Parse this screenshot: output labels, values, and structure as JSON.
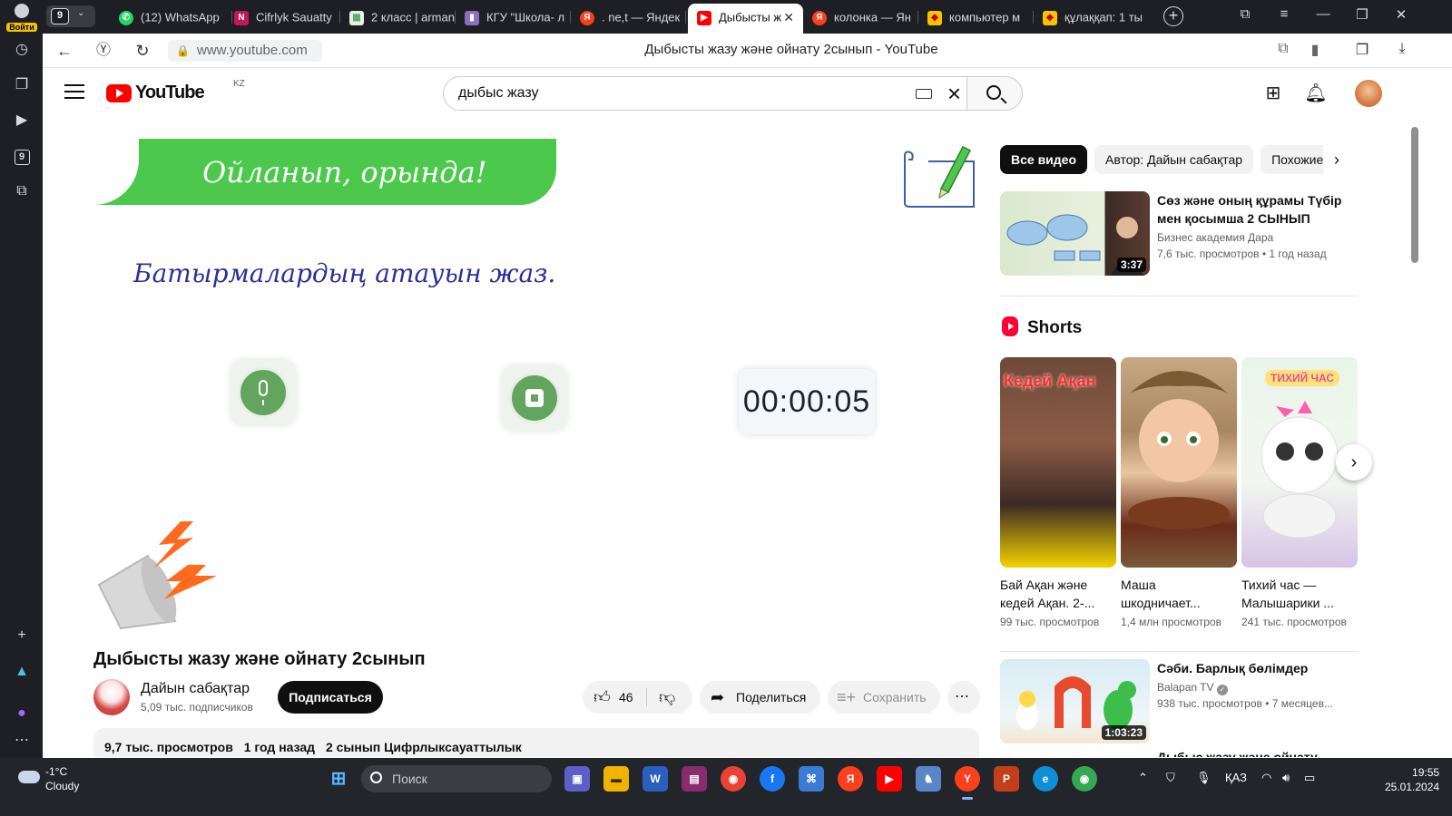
{
  "browser": {
    "login_label": "Войти",
    "tab_count": "9",
    "tabs": [
      {
        "title": "(12) WhatsApp",
        "icon": "whatsapp-icon",
        "color": "#25d366"
      },
      {
        "title": "Cifrlyk Sauatty",
        "icon": "cifrlyk-icon",
        "color": "#c2185b"
      },
      {
        "title": "2 класс | arman",
        "icon": "arman-icon",
        "color": "#5aa469"
      },
      {
        "title": "КГУ \"Школа- л",
        "icon": "school-icon",
        "color": "#8e6cc0"
      },
      {
        "title": ". ne,t — Яндек",
        "icon": "yandex-icon",
        "color": "#fc3f1d"
      },
      {
        "title": "Дыбысты ж",
        "icon": "youtube-icon",
        "color": "#ff0000"
      },
      {
        "title": "колонка — Ян",
        "icon": "yandex-icon",
        "color": "#fc3f1d"
      },
      {
        "title": "компьютер м",
        "icon": "images-icon",
        "color": "#f8c300"
      },
      {
        "title": "құлаққап: 1 ты",
        "icon": "images-icon",
        "color": "#f8c300"
      }
    ],
    "url": "www.youtube.com",
    "page_title": "Дыбысты жазу және ойнату 2сынып - YouTube"
  },
  "youtube": {
    "logo_text": "YouTube",
    "country_code": "KZ",
    "search_value": "дыбыс жазу"
  },
  "video": {
    "banner_text": "Ойланып, орында!",
    "task_text": "Батырмалардың атауын жаз.",
    "timer": "00:00:05",
    "title": "Дыбысты жазу және ойнату 2сынып",
    "channel": "Дайын сабақтар",
    "subscribers": "5,09 тыс. подписчиков",
    "subscribe_label": "Подписаться",
    "likes": "46",
    "share_label": "Поделиться",
    "save_label": "Сохранить",
    "views": "9,7 тыс. просмотров",
    "age": "1 год назад",
    "tags": "2 сынып Цифрлыксауаттылык"
  },
  "sidebar": {
    "chips": [
      "Все видео",
      "Автор: Дайын сабақтар",
      "Похожие"
    ],
    "recommendations": [
      {
        "title": "Сөз және оның құрамы Түбір мен қосымша 2 СЫНЫП",
        "channel": "Бизнес академия Дара",
        "meta": "7,6 тыс. просмотров • 1 год назад",
        "duration": "3:37"
      },
      {
        "title": "Сәби. Барлық бөлімдер",
        "channel": "Balapan TV",
        "meta": "938 тыс. просмотров • 7 месяцев...",
        "duration": "1:03:23"
      }
    ],
    "shorts_heading": "Shorts",
    "shorts": [
      {
        "title": "Бай Ақан және кедей Ақан. 2-...",
        "views": "99 тыс. просмотров",
        "overlay": "Кедей Ақан"
      },
      {
        "title": "Маша шкодничает...",
        "views": "1,4 млн просмотров",
        "overlay": ""
      },
      {
        "title": "Тихий час — Малышарики ...",
        "views": "241 тыс. просмотров",
        "overlay": "ТИХИЙ ЧАС"
      }
    ],
    "next_title_partial": "Дыбыс жазу және ойнату"
  },
  "taskbar": {
    "temperature": "-1°C",
    "condition": "Cloudy",
    "search_placeholder": "Поиск",
    "language": "ҚАЗ",
    "time": "19:55",
    "date": "25.01.2024"
  }
}
